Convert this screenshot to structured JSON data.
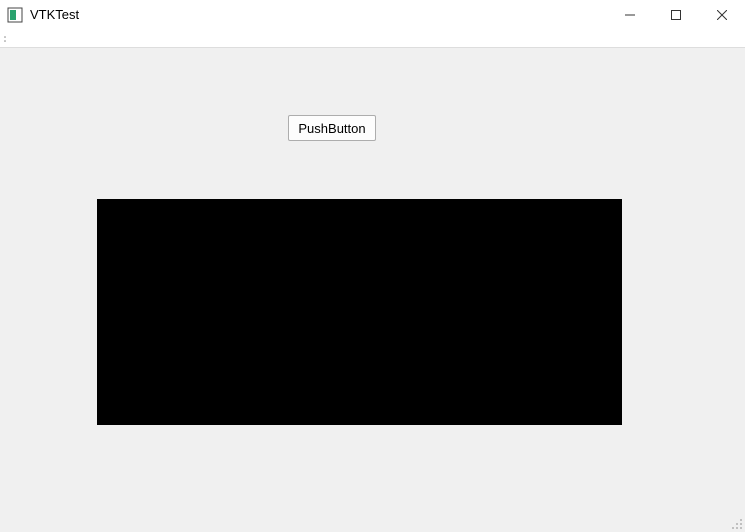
{
  "window": {
    "title": "VTKTest"
  },
  "controls": {
    "push_button_label": "PushButton"
  }
}
